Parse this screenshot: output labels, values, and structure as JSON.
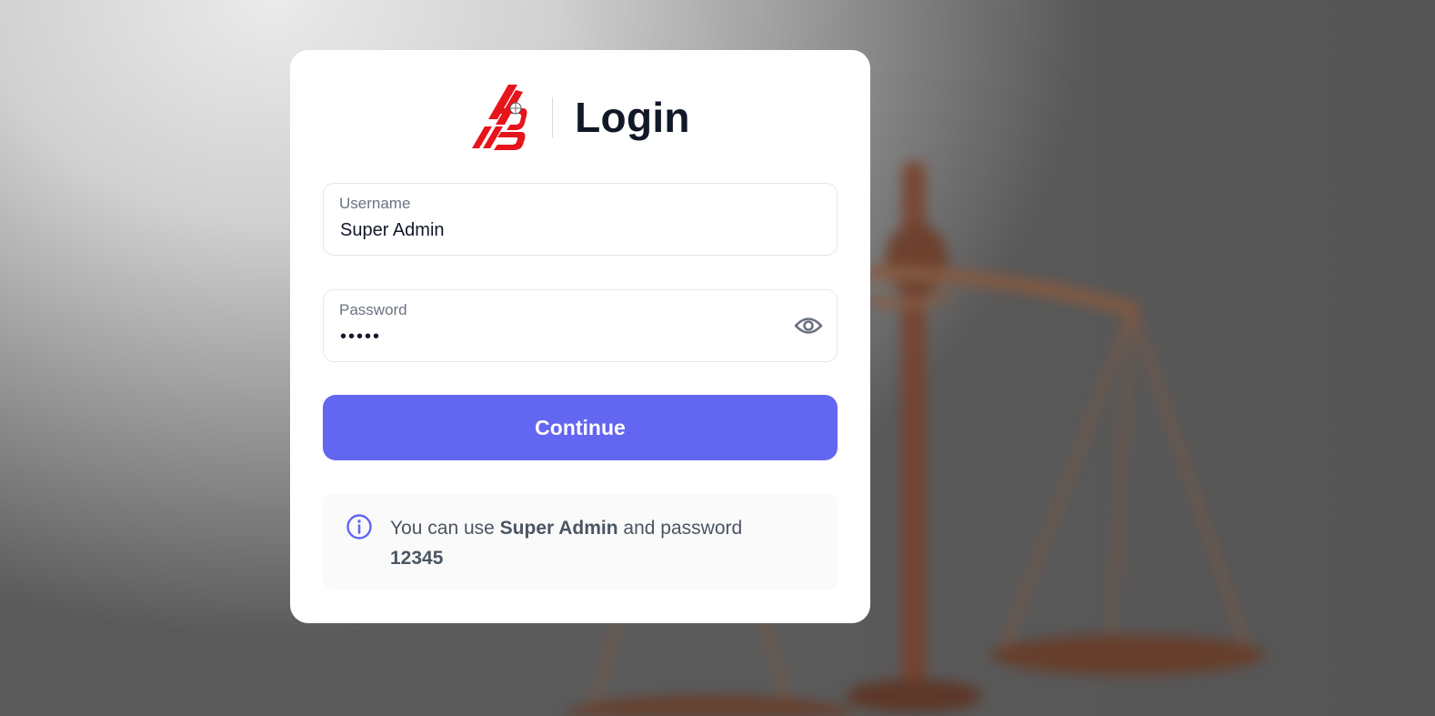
{
  "login": {
    "title": "Login",
    "logo_icon": "company-logo-icon",
    "username": {
      "label": "Username",
      "value": "Super Admin"
    },
    "password": {
      "label": "Password",
      "masked_value": "•••••",
      "toggle_icon": "eye-icon"
    },
    "continue_label": "Continue",
    "hint": {
      "icon": "info-icon",
      "prefix": "You can use",
      "username": "Super Admin",
      "middle": "and password",
      "password": "12345"
    }
  },
  "colors": {
    "accent": "#6366f1",
    "logo_red": "#e8141b",
    "title": "#111827"
  }
}
